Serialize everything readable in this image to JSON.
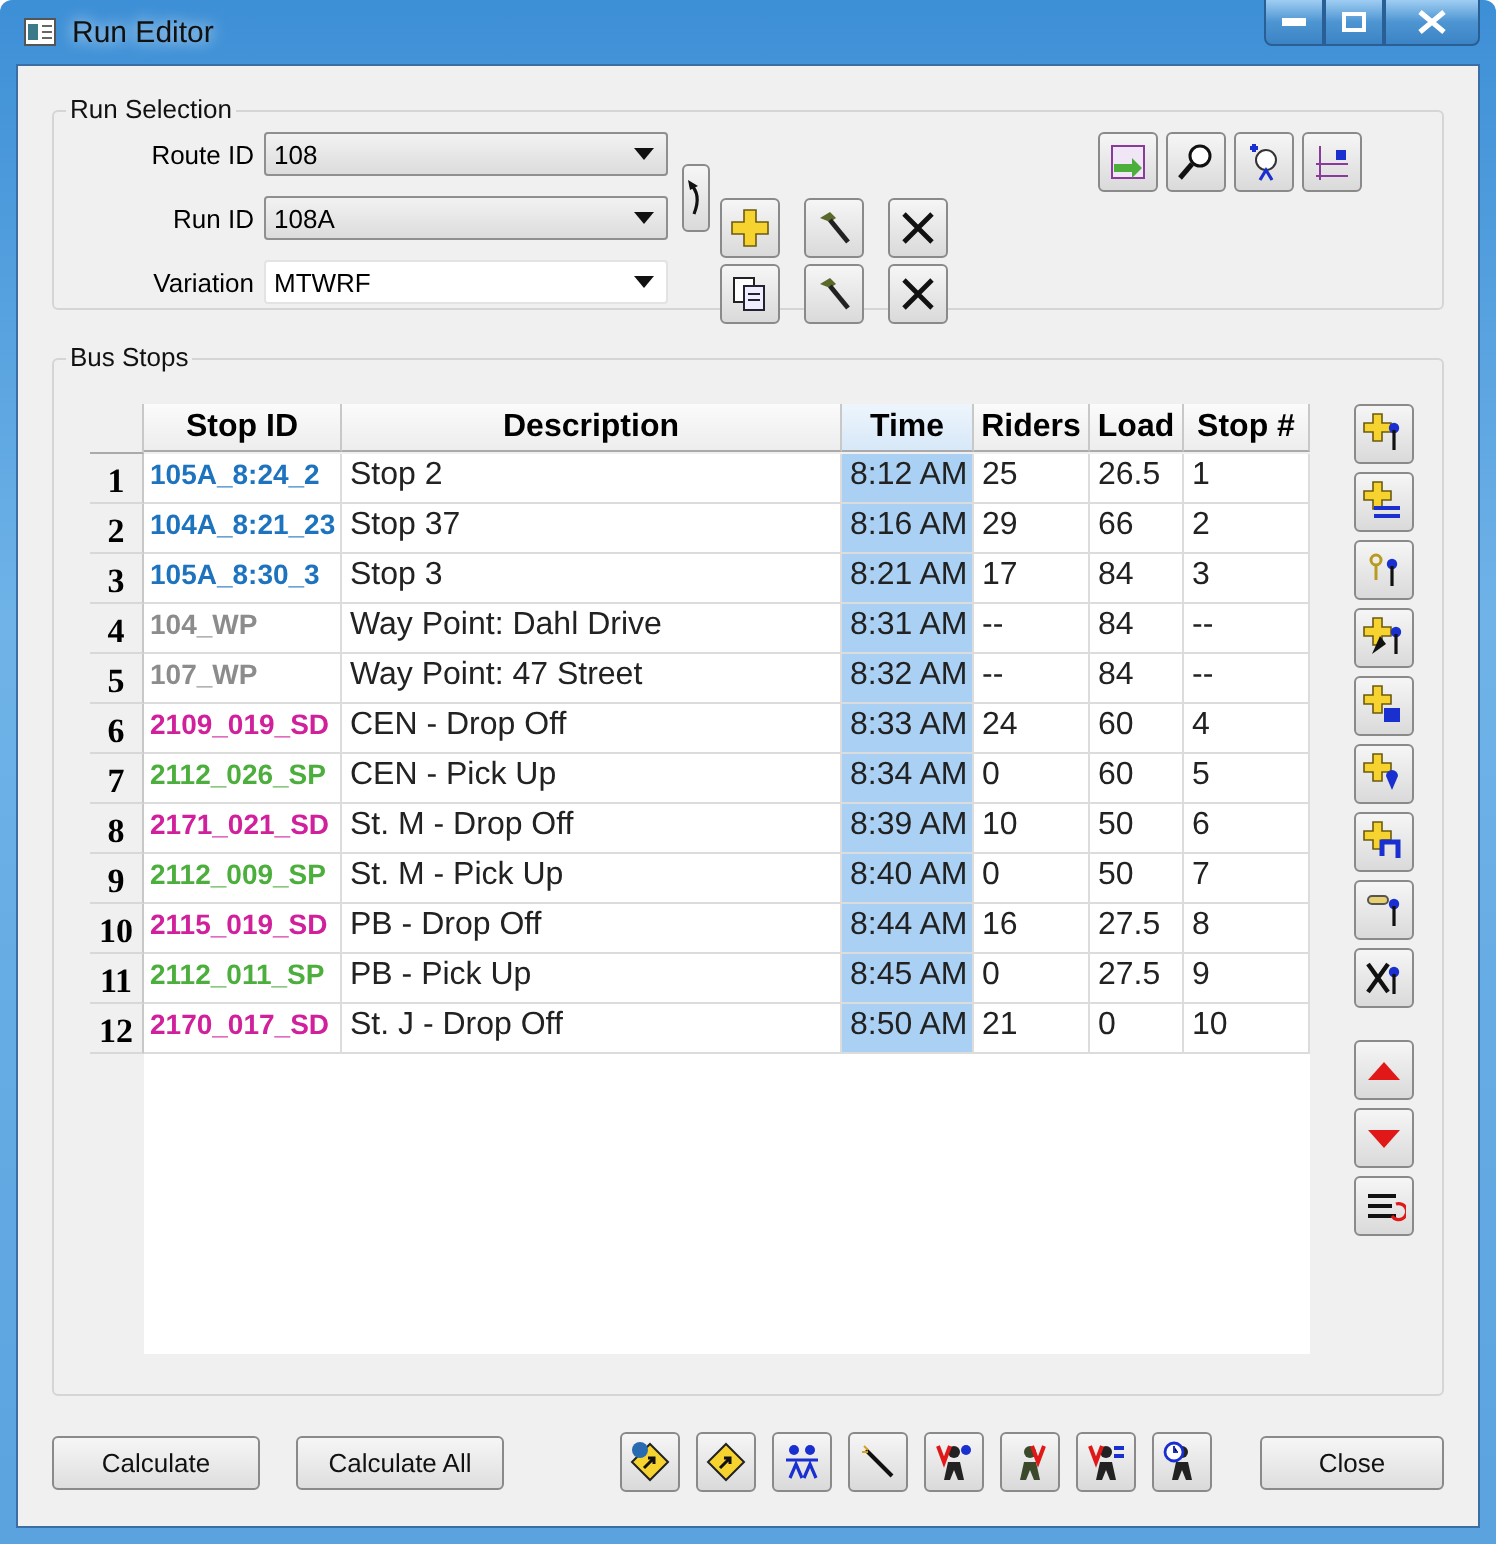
{
  "window": {
    "title": "Run Editor"
  },
  "run_selection": {
    "title": "Run Selection",
    "fields": [
      {
        "label": "Route ID",
        "value": "108",
        "kind": "dropdown"
      },
      {
        "label": "Run ID",
        "value": "108A",
        "kind": "dropdown"
      },
      {
        "label": "Variation",
        "value": "MTWRF",
        "kind": "combo"
      }
    ]
  },
  "bus_stops": {
    "title": "Bus Stops",
    "columns": [
      {
        "label": "Stop ID",
        "selected": false
      },
      {
        "label": "Description",
        "selected": false
      },
      {
        "label": "Time",
        "selected": true
      },
      {
        "label": "Riders",
        "selected": false
      },
      {
        "label": "Load",
        "selected": false
      },
      {
        "label": "Stop #",
        "selected": false
      }
    ],
    "rows": [
      {
        "number": "1",
        "stop_id": "105A_8:24_2",
        "color": "#1e73be",
        "description": "Stop 2",
        "time": "8:12 AM",
        "riders": "25",
        "load": "26.5",
        "stop_no": "1"
      },
      {
        "number": "2",
        "stop_id": "104A_8:21_23",
        "color": "#1e73be",
        "description": "Stop 37",
        "time": "8:16 AM",
        "riders": "29",
        "load": "66",
        "stop_no": "2"
      },
      {
        "number": "3",
        "stop_id": "105A_8:30_3",
        "color": "#1e73be",
        "description": "Stop 3",
        "time": "8:21 AM",
        "riders": "17",
        "load": "84",
        "stop_no": "3"
      },
      {
        "number": "4",
        "stop_id": "104_WP",
        "color": "#8c8c8c",
        "description": "Way Point: Dahl Drive",
        "time": "8:31 AM",
        "riders": "--",
        "load": "84",
        "stop_no": "--"
      },
      {
        "number": "5",
        "stop_id": "107_WP",
        "color": "#8c8c8c",
        "description": "Way Point: 47 Street",
        "time": "8:32 AM",
        "riders": "--",
        "load": "84",
        "stop_no": "--"
      },
      {
        "number": "6",
        "stop_id": "2109_019_SD",
        "color": "#d0209c",
        "description": "CEN - Drop Off",
        "time": "8:33 AM",
        "riders": "24",
        "load": "60",
        "stop_no": "4"
      },
      {
        "number": "7",
        "stop_id": "2112_026_SP",
        "color": "#4cae3c",
        "description": "CEN - Pick Up",
        "time": "8:34 AM",
        "riders": "0",
        "load": "60",
        "stop_no": "5"
      },
      {
        "number": "8",
        "stop_id": "2171_021_SD",
        "color": "#d0209c",
        "description": "St. M - Drop Off",
        "time": "8:39 AM",
        "riders": "10",
        "load": "50",
        "stop_no": "6"
      },
      {
        "number": "9",
        "stop_id": "2112_009_SP",
        "color": "#4cae3c",
        "description": "St. M - Pick Up",
        "time": "8:40 AM",
        "riders": "0",
        "load": "50",
        "stop_no": "7"
      },
      {
        "number": "10",
        "stop_id": "2115_019_SD",
        "color": "#d0209c",
        "description": "PB - Drop Off",
        "time": "8:44 AM",
        "riders": "16",
        "load": "27.5",
        "stop_no": "8"
      },
      {
        "number": "11",
        "stop_id": "2112_011_SP",
        "color": "#4cae3c",
        "description": "PB - Pick Up",
        "time": "8:45 AM",
        "riders": "0",
        "load": "27.5",
        "stop_no": "9"
      },
      {
        "number": "12",
        "stop_id": "2170_017_SD",
        "color": "#d0209c",
        "description": "St. J - Drop Off",
        "time": "8:50 AM",
        "riders": "21",
        "load": "0",
        "stop_no": "10"
      }
    ]
  },
  "buttons": [
    {
      "label": "Calculate"
    },
    {
      "label": "Calculate All"
    }
  ],
  "close_button": {
    "label": "Close"
  }
}
